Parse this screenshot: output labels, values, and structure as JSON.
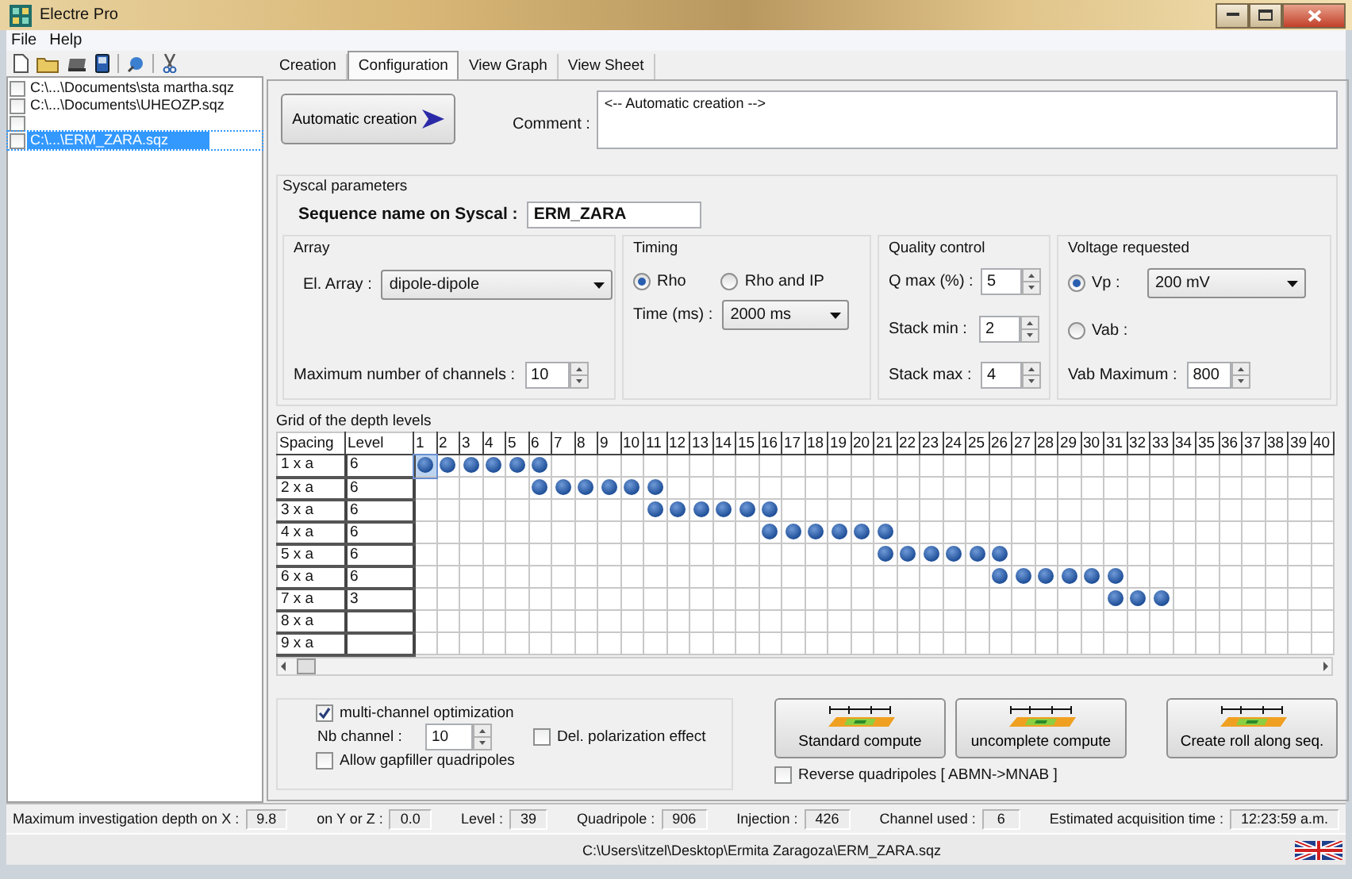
{
  "window": {
    "title": "Electre Pro"
  },
  "menu": [
    "File",
    "Help"
  ],
  "sidebar": {
    "files": [
      {
        "path": "C:\\...\\Documents\\sta martha.sqz",
        "checked": false,
        "selected": false
      },
      {
        "path": "C:\\...\\Documents\\UHEOZP.sqz",
        "checked": false,
        "selected": false
      },
      {
        "checked": false,
        "selected": false
      },
      {
        "path": "C:\\...\\ERM_ZARA.sqz",
        "checked": false,
        "selected": true
      }
    ]
  },
  "tabs": [
    {
      "label": "Creation",
      "selected": false
    },
    {
      "label": "Configuration",
      "selected": true
    },
    {
      "label": "View Graph",
      "selected": false
    },
    {
      "label": "View Sheet",
      "selected": false
    }
  ],
  "creation": {
    "button": "Automatic creation",
    "comment_label": "Comment :",
    "comment": "<-- Automatic creation -->"
  },
  "syscal": {
    "title": "Syscal parameters",
    "sequence_label": "Sequence name on Syscal :",
    "sequence_name": "ERM_ZARA",
    "array": {
      "title": "Array",
      "el_label": "El. Array :",
      "el_value": "dipole-dipole",
      "channels_label": "Maximum number of channels :",
      "channels": "10"
    },
    "timing": {
      "title": "Timing",
      "options": [
        {
          "label": "Rho",
          "selected": true
        },
        {
          "label": "Rho and  IP",
          "selected": false
        }
      ],
      "time_label": "Time (ms) :",
      "time": "2000 ms"
    },
    "quality": {
      "title": "Quality control",
      "fields": [
        {
          "label": "Q max (%) :",
          "value": "5"
        },
        {
          "label": "Stack min :",
          "value": "2"
        },
        {
          "label": "Stack max :",
          "value": "4"
        }
      ]
    },
    "voltage": {
      "title": "Voltage requested",
      "options": [
        {
          "label": "Vp :",
          "selected": true,
          "value": "200 mV"
        },
        {
          "label": "Vab :",
          "selected": false
        }
      ],
      "max_label": "Vab Maximum :",
      "max": "800"
    }
  },
  "grid": {
    "title": "Grid of the depth levels",
    "spacing_header": "Spacing",
    "level_header": "Level",
    "numbers": [
      "1",
      "2",
      "3",
      "4",
      "5",
      "6",
      "7",
      "8",
      "9",
      "10",
      "11",
      "12",
      "13",
      "14",
      "15",
      "16",
      "17",
      "18",
      "19",
      "20",
      "21",
      "22",
      "23",
      "24",
      "25",
      "26",
      "27",
      "28",
      "29",
      "30",
      "31",
      "32",
      "33",
      "34",
      "35",
      "36",
      "37",
      "38",
      "39",
      "40"
    ],
    "rows": [
      {
        "spacing": "1 x a",
        "level": "6",
        "selected": true,
        "filled": [
          true,
          true,
          true,
          true,
          true,
          true,
          false,
          false,
          false,
          false,
          false,
          false,
          false,
          false,
          false,
          false,
          false,
          false,
          false,
          false,
          false,
          false,
          false,
          false,
          false,
          false,
          false,
          false,
          false,
          false,
          false,
          false,
          false,
          false,
          false,
          false,
          false,
          false,
          false,
          false
        ]
      },
      {
        "spacing": "2 x a",
        "level": "6",
        "selected": false,
        "filled": [
          false,
          false,
          false,
          false,
          false,
          true,
          true,
          true,
          true,
          true,
          true,
          false,
          false,
          false,
          false,
          false,
          false,
          false,
          false,
          false,
          false,
          false,
          false,
          false,
          false,
          false,
          false,
          false,
          false,
          false,
          false,
          false,
          false,
          false,
          false,
          false,
          false,
          false,
          false,
          false
        ]
      },
      {
        "spacing": "3 x a",
        "level": "6",
        "selected": false,
        "filled": [
          false,
          false,
          false,
          false,
          false,
          false,
          false,
          false,
          false,
          false,
          true,
          true,
          true,
          true,
          true,
          true,
          false,
          false,
          false,
          false,
          false,
          false,
          false,
          false,
          false,
          false,
          false,
          false,
          false,
          false,
          false,
          false,
          false,
          false,
          false,
          false,
          false,
          false,
          false,
          false
        ]
      },
      {
        "spacing": "4 x a",
        "level": "6",
        "selected": false,
        "filled": [
          false,
          false,
          false,
          false,
          false,
          false,
          false,
          false,
          false,
          false,
          false,
          false,
          false,
          false,
          false,
          true,
          true,
          true,
          true,
          true,
          true,
          false,
          false,
          false,
          false,
          false,
          false,
          false,
          false,
          false,
          false,
          false,
          false,
          false,
          false,
          false,
          false,
          false,
          false,
          false
        ]
      },
      {
        "spacing": "5 x a",
        "level": "6",
        "selected": false,
        "filled": [
          false,
          false,
          false,
          false,
          false,
          false,
          false,
          false,
          false,
          false,
          false,
          false,
          false,
          false,
          false,
          false,
          false,
          false,
          false,
          false,
          true,
          true,
          true,
          true,
          true,
          true,
          false,
          false,
          false,
          false,
          false,
          false,
          false,
          false,
          false,
          false,
          false,
          false,
          false,
          false
        ]
      },
      {
        "spacing": "6 x a",
        "level": "6",
        "selected": false,
        "filled": [
          false,
          false,
          false,
          false,
          false,
          false,
          false,
          false,
          false,
          false,
          false,
          false,
          false,
          false,
          false,
          false,
          false,
          false,
          false,
          false,
          false,
          false,
          false,
          false,
          false,
          true,
          true,
          true,
          true,
          true,
          true,
          false,
          false,
          false,
          false,
          false,
          false,
          false,
          false,
          false
        ]
      },
      {
        "spacing": "7 x a",
        "level": "3",
        "selected": false,
        "filled": [
          false,
          false,
          false,
          false,
          false,
          false,
          false,
          false,
          false,
          false,
          false,
          false,
          false,
          false,
          false,
          false,
          false,
          false,
          false,
          false,
          false,
          false,
          false,
          false,
          false,
          false,
          false,
          false,
          false,
          false,
          true,
          true,
          true,
          false,
          false,
          false,
          false,
          false,
          false,
          false
        ]
      },
      {
        "spacing": "8 x a",
        "selected": false,
        "filled": [
          false,
          false,
          false,
          false,
          false,
          false,
          false,
          false,
          false,
          false,
          false,
          false,
          false,
          false,
          false,
          false,
          false,
          false,
          false,
          false,
          false,
          false,
          false,
          false,
          false,
          false,
          false,
          false,
          false,
          false,
          false,
          false,
          false,
          false,
          false,
          false,
          false,
          false,
          false,
          false
        ]
      },
      {
        "spacing": "9 x a",
        "selected": false,
        "filled": [
          false,
          false,
          false,
          false,
          false,
          false,
          false,
          false,
          false,
          false,
          false,
          false,
          false,
          false,
          false,
          false,
          false,
          false,
          false,
          false,
          false,
          false,
          false,
          false,
          false,
          false,
          false,
          false,
          false,
          false,
          false,
          false,
          false,
          false,
          false,
          false,
          false,
          false,
          false,
          false
        ]
      }
    ]
  },
  "options": {
    "multi_channel": {
      "label": "multi-channel optimization",
      "checked": true
    },
    "nb_label": "Nb channel :",
    "nb": "10",
    "del_polarization": {
      "label": "Del. polarization effect",
      "checked": false
    },
    "gapfiller": {
      "label": "Allow gapfiller quadripoles",
      "checked": false
    }
  },
  "compute_buttons": [
    "Standard compute",
    "uncomplete compute",
    "Create roll along seq."
  ],
  "reverse": {
    "label": "Reverse quadripoles  [  ABMN->MNAB  ]",
    "checked": false
  },
  "status": [
    {
      "label": "Maximum investigation depth on X :",
      "value": "9.8"
    },
    {
      "label": "on Y or Z :",
      "value": "0.0"
    },
    {
      "label": "Level :",
      "value": "39"
    },
    {
      "label": "Quadripole :",
      "value": "906"
    },
    {
      "label": "Injection :",
      "value": "426"
    },
    {
      "label": "Channel used :",
      "value": "6"
    },
    {
      "label": "Estimated acquisition time :",
      "value": "12:23:59 a.m."
    }
  ],
  "path": "C:\\Users\\itzel\\Desktop\\Ermita Zaragoza\\ERM_ZARA.sqz"
}
